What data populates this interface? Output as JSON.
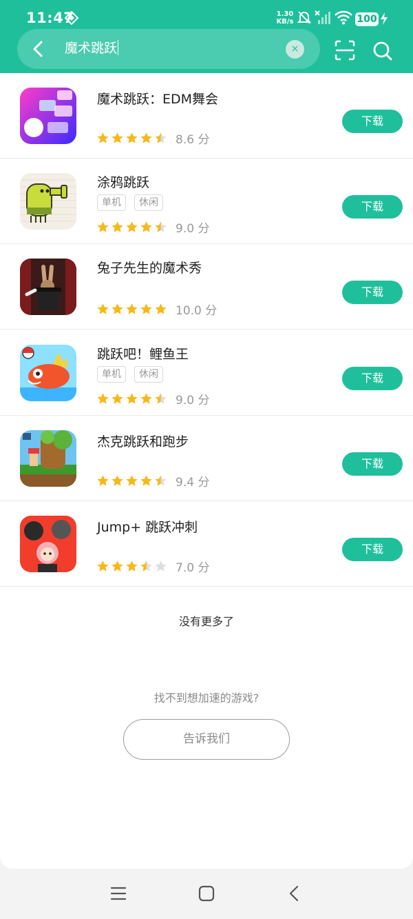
{
  "status": {
    "time": "11:47",
    "net_speed_value": "1.30",
    "net_speed_unit": "KB/s",
    "battery": "100"
  },
  "search": {
    "query": "魔术跳跃",
    "clear_symbol": "×"
  },
  "colors": {
    "accent": "#1fbf9c",
    "star": "#f8b817",
    "star_empty": "#dddddd"
  },
  "apps": [
    {
      "name": "魔术跳跃：EDM舞会",
      "tags": [],
      "rating_stars": 4.5,
      "score": "8.6 分",
      "button": "下载"
    },
    {
      "name": "涂鸦跳跃",
      "tags": [
        "单机",
        "休闲"
      ],
      "rating_stars": 4.5,
      "score": "9.0 分",
      "button": "下载"
    },
    {
      "name": "兔子先生的魔术秀",
      "tags": [],
      "rating_stars": 5,
      "score": "10.0 分",
      "button": "下载"
    },
    {
      "name": "跳跃吧！鲤鱼王",
      "tags": [
        "单机",
        "休闲"
      ],
      "rating_stars": 4.5,
      "score": "9.0 分",
      "button": "下载"
    },
    {
      "name": "杰克跳跃和跑步",
      "tags": [],
      "rating_stars": 4.5,
      "score": "9.4 分",
      "button": "下载"
    },
    {
      "name": "Jump+ 跳跃冲刺",
      "tags": [],
      "rating_stars": 3.5,
      "score": "7.0 分",
      "button": "下载"
    }
  ],
  "footer": {
    "no_more": "没有更多了",
    "cant_find": "找不到想加速的游戏?",
    "tell_us": "告诉我们"
  },
  "icons": {
    "back": "chevron-left-icon",
    "scan": "scan-icon",
    "search": "search-icon",
    "menu": "menu-icon",
    "home": "home-icon"
  }
}
